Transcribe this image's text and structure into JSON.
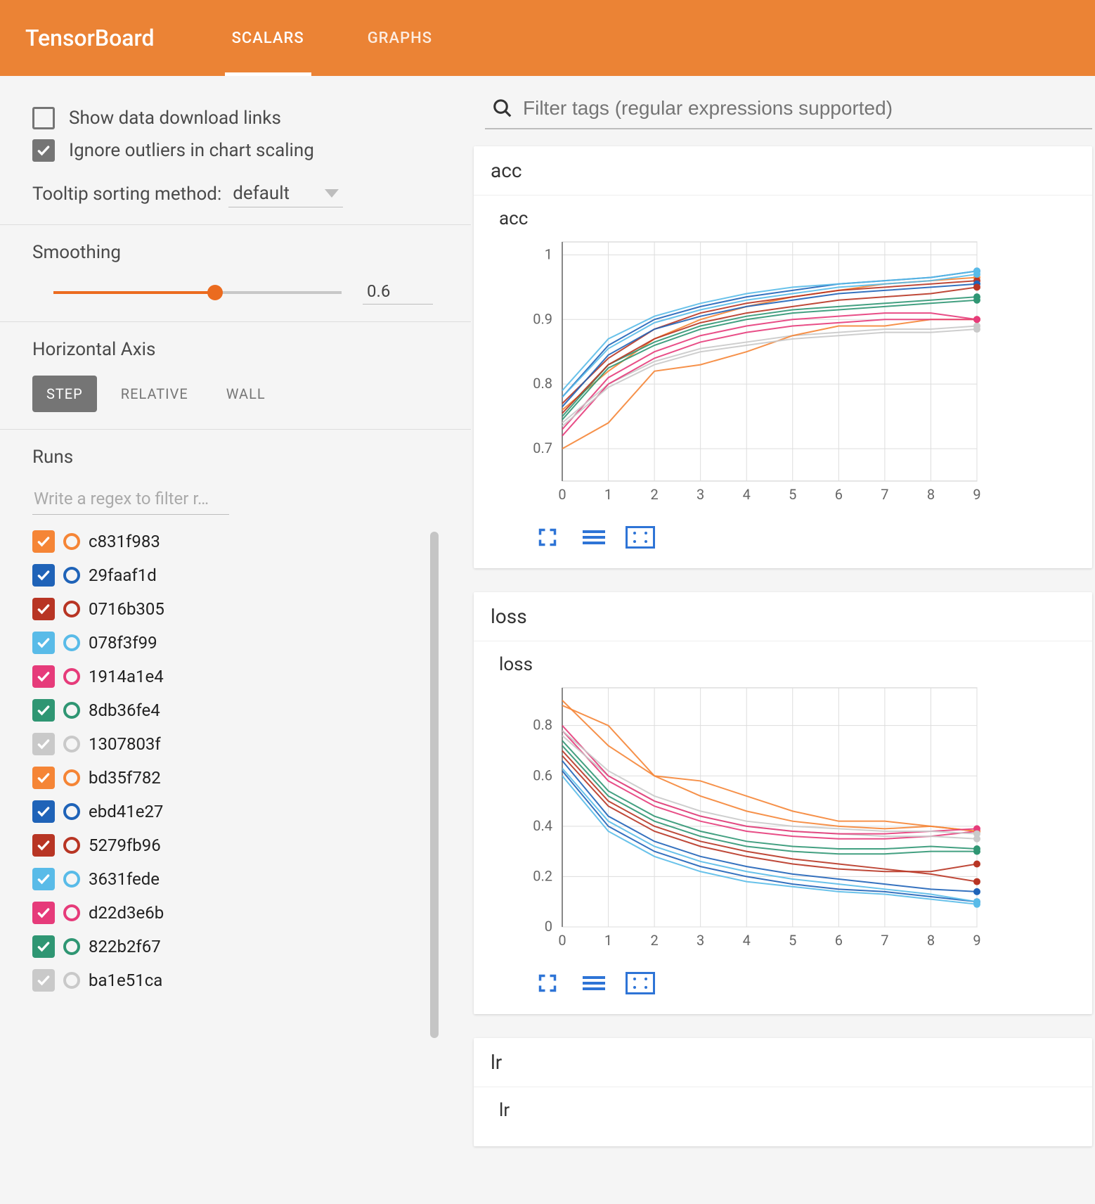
{
  "header": {
    "brand": "TensorBoard",
    "tabs": [
      {
        "label": "SCALARS",
        "active": true
      },
      {
        "label": "GRAPHS",
        "active": false
      }
    ]
  },
  "sidebar": {
    "show_download_label": "Show data download links",
    "show_download_checked": false,
    "ignore_outliers_label": "Ignore outliers in chart scaling",
    "ignore_outliers_checked": true,
    "tooltip_label": "Tooltip sorting method:",
    "tooltip_value": "default",
    "smoothing": {
      "label": "Smoothing",
      "value": "0.6",
      "fraction": 0.56
    },
    "axis": {
      "label": "Horizontal Axis",
      "options": [
        {
          "label": "STEP",
          "active": true
        },
        {
          "label": "RELATIVE",
          "active": false
        },
        {
          "label": "WALL",
          "active": false
        }
      ]
    },
    "runs": {
      "label": "Runs",
      "filter_placeholder": "Write a regex to filter r…",
      "items": [
        {
          "name": "c831f983",
          "color": "#f58536",
          "checked": true
        },
        {
          "name": "29faaf1d",
          "color": "#1f63b8",
          "checked": true
        },
        {
          "name": "0716b305",
          "color": "#b83524",
          "checked": true
        },
        {
          "name": "078f3f99",
          "color": "#59bbe8",
          "checked": true
        },
        {
          "name": "1914a1e4",
          "color": "#e63b7a",
          "checked": true
        },
        {
          "name": "8db36fe4",
          "color": "#2f9673",
          "checked": true
        },
        {
          "name": "1307803f",
          "color": "#c9c9c9",
          "checked": true
        },
        {
          "name": "bd35f782",
          "color": "#f58536",
          "checked": true
        },
        {
          "name": "ebd41e27",
          "color": "#1f63b8",
          "checked": true
        },
        {
          "name": "5279fb96",
          "color": "#b83524",
          "checked": true
        },
        {
          "name": "3631fede",
          "color": "#59bbe8",
          "checked": true
        },
        {
          "name": "d22d3e6b",
          "color": "#e63b7a",
          "checked": true
        },
        {
          "name": "822b2f67",
          "color": "#2f9673",
          "checked": true
        },
        {
          "name": "ba1e51ca",
          "color": "#c9c9c9",
          "checked": true
        }
      ]
    }
  },
  "main": {
    "filter_placeholder": "Filter tags (regular expressions supported)",
    "panels": [
      {
        "tag": "acc",
        "chart_title": "acc"
      },
      {
        "tag": "loss",
        "chart_title": "loss"
      },
      {
        "tag": "lr",
        "chart_title": "lr"
      }
    ]
  },
  "chart_data": [
    {
      "type": "line",
      "title": "acc",
      "xlabel": "",
      "ylabel": "",
      "xticks": [
        0,
        1,
        2,
        3,
        4,
        5,
        6,
        7,
        8,
        9
      ],
      "yticks": [
        0.7,
        0.8,
        0.9,
        1.0
      ],
      "xlim": [
        0,
        9
      ],
      "ylim": [
        0.65,
        1.02
      ],
      "colors": [
        "#f58536",
        "#1f63b8",
        "#b83524",
        "#59bbe8",
        "#e63b7a",
        "#2f9673",
        "#c9c9c9",
        "#f58536",
        "#1f63b8",
        "#b83524",
        "#59bbe8",
        "#e63b7a",
        "#2f9673",
        "#c9c9c9"
      ],
      "x": [
        0,
        1,
        2,
        3,
        4,
        5,
        6,
        7,
        8,
        9
      ],
      "series": [
        {
          "name": "c831f983",
          "values": [
            0.76,
            0.82,
            0.87,
            0.9,
            0.92,
            0.935,
            0.945,
            0.955,
            0.96,
            0.965
          ]
        },
        {
          "name": "29faaf1d",
          "values": [
            0.78,
            0.86,
            0.9,
            0.92,
            0.935,
            0.945,
            0.955,
            0.96,
            0.965,
            0.975
          ]
        },
        {
          "name": "0716b305",
          "values": [
            0.77,
            0.84,
            0.885,
            0.91,
            0.925,
            0.935,
            0.945,
            0.95,
            0.955,
            0.96
          ]
        },
        {
          "name": "078f3f99",
          "values": [
            0.79,
            0.87,
            0.905,
            0.925,
            0.94,
            0.95,
            0.955,
            0.96,
            0.965,
            0.975
          ]
        },
        {
          "name": "1914a1e4",
          "values": [
            0.73,
            0.81,
            0.85,
            0.875,
            0.89,
            0.9,
            0.905,
            0.91,
            0.91,
            0.9
          ]
        },
        {
          "name": "8db36fe4",
          "values": [
            0.75,
            0.83,
            0.865,
            0.89,
            0.905,
            0.915,
            0.92,
            0.925,
            0.93,
            0.935
          ]
        },
        {
          "name": "1307803f",
          "values": [
            0.74,
            0.8,
            0.835,
            0.855,
            0.865,
            0.875,
            0.88,
            0.885,
            0.885,
            0.89
          ]
        },
        {
          "name": "bd35f782",
          "values": [
            0.7,
            0.74,
            0.82,
            0.83,
            0.85,
            0.875,
            0.89,
            0.89,
            0.9,
            0.9
          ]
        },
        {
          "name": "ebd41e27",
          "values": [
            0.765,
            0.845,
            0.885,
            0.905,
            0.92,
            0.93,
            0.94,
            0.945,
            0.95,
            0.955
          ]
        },
        {
          "name": "5279fb96",
          "values": [
            0.755,
            0.83,
            0.87,
            0.895,
            0.91,
            0.92,
            0.93,
            0.935,
            0.94,
            0.95
          ]
        },
        {
          "name": "3631fede",
          "values": [
            0.78,
            0.855,
            0.895,
            0.915,
            0.93,
            0.94,
            0.95,
            0.955,
            0.96,
            0.97
          ]
        },
        {
          "name": "d22d3e6b",
          "values": [
            0.72,
            0.8,
            0.84,
            0.865,
            0.88,
            0.89,
            0.895,
            0.9,
            0.9,
            0.9
          ]
        },
        {
          "name": "822b2f67",
          "values": [
            0.745,
            0.825,
            0.86,
            0.885,
            0.9,
            0.91,
            0.915,
            0.92,
            0.925,
            0.93
          ]
        },
        {
          "name": "ba1e51ca",
          "values": [
            0.735,
            0.795,
            0.83,
            0.85,
            0.86,
            0.87,
            0.875,
            0.88,
            0.88,
            0.885
          ]
        }
      ]
    },
    {
      "type": "line",
      "title": "loss",
      "xlabel": "",
      "ylabel": "",
      "xticks": [
        0,
        1,
        2,
        3,
        4,
        5,
        6,
        7,
        8,
        9
      ],
      "yticks": [
        0,
        0.2,
        0.4,
        0.6,
        0.8
      ],
      "xlim": [
        0,
        9
      ],
      "ylim": [
        0,
        0.95
      ],
      "colors": [
        "#f58536",
        "#1f63b8",
        "#b83524",
        "#59bbe8",
        "#e63b7a",
        "#2f9673",
        "#c9c9c9",
        "#f58536",
        "#1f63b8",
        "#b83524",
        "#59bbe8",
        "#e63b7a",
        "#2f9673",
        "#c9c9c9"
      ],
      "x": [
        0,
        1,
        2,
        3,
        4,
        5,
        6,
        7,
        8,
        9
      ],
      "series": [
        {
          "name": "c831f983",
          "values": [
            0.9,
            0.72,
            0.6,
            0.52,
            0.46,
            0.42,
            0.4,
            0.39,
            0.4,
            0.38
          ]
        },
        {
          "name": "29faaf1d",
          "values": [
            0.62,
            0.4,
            0.3,
            0.24,
            0.2,
            0.17,
            0.15,
            0.14,
            0.12,
            0.1
          ]
        },
        {
          "name": "0716b305",
          "values": [
            0.68,
            0.48,
            0.38,
            0.32,
            0.28,
            0.25,
            0.23,
            0.22,
            0.22,
            0.25
          ]
        },
        {
          "name": "078f3f99",
          "values": [
            0.6,
            0.38,
            0.28,
            0.22,
            0.18,
            0.16,
            0.14,
            0.13,
            0.11,
            0.09
          ]
        },
        {
          "name": "1914a1e4",
          "values": [
            0.78,
            0.58,
            0.48,
            0.42,
            0.38,
            0.36,
            0.35,
            0.35,
            0.36,
            0.38
          ]
        },
        {
          "name": "8db36fe4",
          "values": [
            0.72,
            0.52,
            0.42,
            0.36,
            0.32,
            0.3,
            0.29,
            0.29,
            0.3,
            0.3
          ]
        },
        {
          "name": "1307803f",
          "values": [
            0.76,
            0.6,
            0.5,
            0.44,
            0.4,
            0.38,
            0.37,
            0.36,
            0.36,
            0.35
          ]
        },
        {
          "name": "bd35f782",
          "values": [
            0.88,
            0.8,
            0.6,
            0.58,
            0.52,
            0.46,
            0.42,
            0.42,
            0.4,
            0.38
          ]
        },
        {
          "name": "ebd41e27",
          "values": [
            0.66,
            0.44,
            0.34,
            0.28,
            0.24,
            0.21,
            0.19,
            0.17,
            0.15,
            0.14
          ]
        },
        {
          "name": "5279fb96",
          "values": [
            0.7,
            0.5,
            0.4,
            0.34,
            0.3,
            0.27,
            0.25,
            0.23,
            0.21,
            0.18
          ]
        },
        {
          "name": "3631fede",
          "values": [
            0.63,
            0.42,
            0.32,
            0.26,
            0.22,
            0.19,
            0.17,
            0.15,
            0.13,
            0.1
          ]
        },
        {
          "name": "d22d3e6b",
          "values": [
            0.8,
            0.6,
            0.5,
            0.44,
            0.4,
            0.38,
            0.37,
            0.37,
            0.38,
            0.39
          ]
        },
        {
          "name": "822b2f67",
          "values": [
            0.74,
            0.54,
            0.44,
            0.38,
            0.34,
            0.32,
            0.31,
            0.31,
            0.32,
            0.31
          ]
        },
        {
          "name": "ba1e51ca",
          "values": [
            0.78,
            0.62,
            0.52,
            0.46,
            0.42,
            0.4,
            0.39,
            0.38,
            0.38,
            0.37
          ]
        }
      ]
    }
  ]
}
